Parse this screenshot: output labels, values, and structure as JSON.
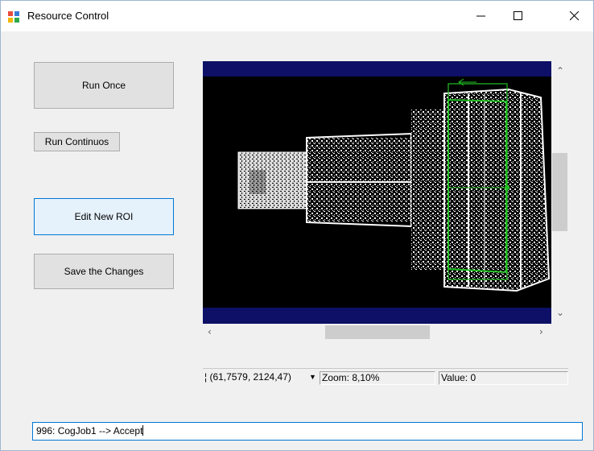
{
  "window": {
    "title": "Resource Control"
  },
  "buttons": {
    "run_once": "Run Once",
    "run_continuous": "Run Continuos",
    "edit_roi": "Edit New ROI",
    "save_changes": "Save the Changes"
  },
  "status": {
    "coords": "(61,7579, 2124,47)",
    "zoom": "Zoom: 8,10%",
    "value": "Value: 0"
  },
  "log": {
    "text": "996: CogJob1 --> Accept"
  },
  "colors": {
    "display_bg": "#000000",
    "display_band": "#0d1066",
    "roi_green": "#22c022",
    "accent": "#0078d7"
  }
}
